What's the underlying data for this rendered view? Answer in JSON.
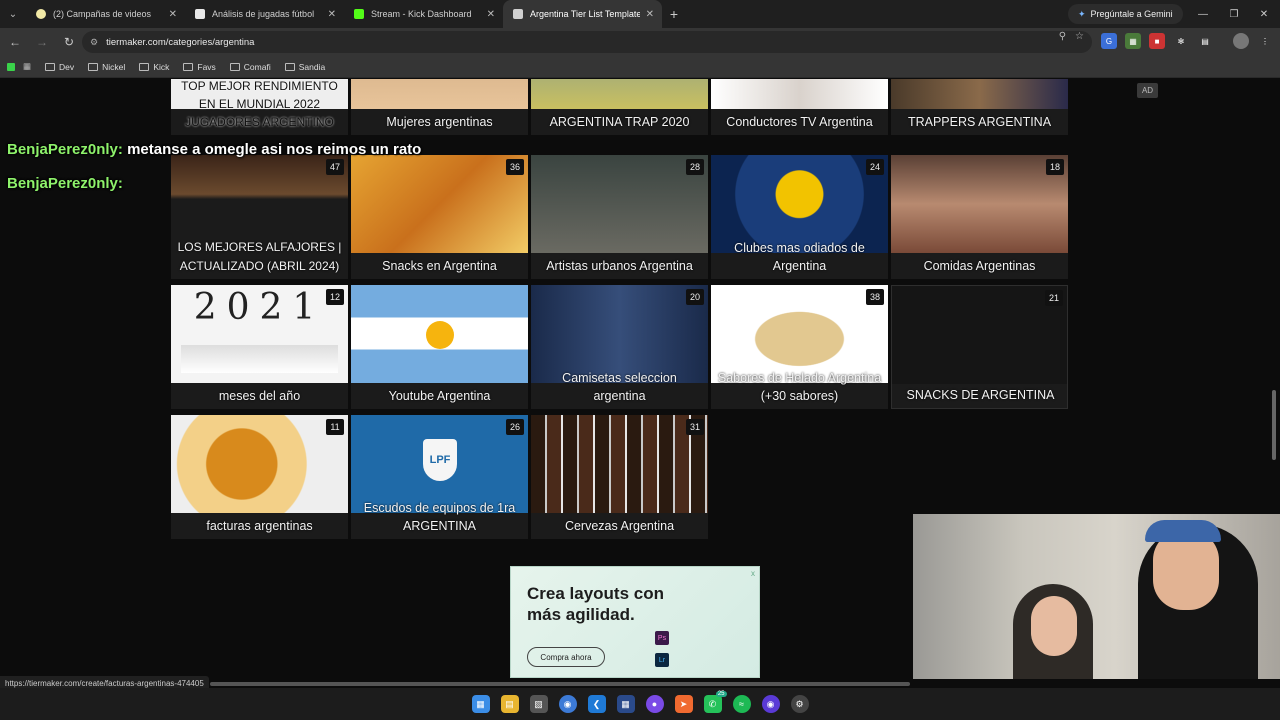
{
  "browser": {
    "tabs": [
      {
        "label": "(2) Campañas de videos",
        "color": "#f2e9a6",
        "active": false
      },
      {
        "label": "Análisis de jugadas fútbol",
        "color": "#e8e8e8",
        "active": false
      },
      {
        "label": "Stream - Kick Dashboard",
        "color": "#53fc18",
        "active": false
      },
      {
        "label": "Argentina Tier List Templates -",
        "color": "#d0d0d0",
        "active": true
      }
    ],
    "gemini_label": "Pregúntale a Gemini",
    "url": "tiermaker.com/categories/argentina",
    "bookmarks": [
      "Dev",
      "Nickel",
      "Kick",
      "Favs",
      "Comafi",
      "Sandia"
    ],
    "status_url": "https://tiermaker.com/create/facturas-argentinas-474405"
  },
  "page": {
    "ad_label": "AD",
    "row0": [
      {
        "title": "TOP MEJOR RENDIMIENTO EN EL MUNDIAL 2022 JUGADORES ARGENTINO",
        "count": ""
      },
      {
        "title": "Mujeres argentinas",
        "count": ""
      },
      {
        "title": "ARGENTINA TRAP 2020",
        "count": ""
      },
      {
        "title": "Conductores TV Argentina",
        "count": ""
      },
      {
        "title": "TRAPPERS ARGENTINA",
        "count": ""
      }
    ],
    "row1": [
      {
        "title": "LOS MEJORES ALFAJORES | ACTUALIZADO (ABRIL 2024)",
        "count": "47"
      },
      {
        "title": "Snacks en Argentina",
        "count": "36"
      },
      {
        "title": "Artistas urbanos Argentina",
        "count": "28"
      },
      {
        "title": "Clubes mas odiados de Argentina",
        "count": "24"
      },
      {
        "title": "Comidas Argentinas",
        "count": "18"
      }
    ],
    "row2": [
      {
        "title": "meses del año",
        "count": "12",
        "big": "2021"
      },
      {
        "title": "Youtube Argentina",
        "count": ""
      },
      {
        "title": "Camisetas seleccion argentina",
        "count": "20"
      },
      {
        "title": "Sabores de Helado Argentina (+30 sabores)",
        "count": "38"
      },
      {
        "title": "SNACKS DE ARGENTINA",
        "count": "21"
      }
    ],
    "row3": [
      {
        "title": "facturas argentinas",
        "count": "11"
      },
      {
        "title": "Escudos de equipos de 1ra ARGENTINA",
        "count": "26",
        "logo": "LPF"
      },
      {
        "title": "Cervezas Argentina",
        "count": "31"
      }
    ],
    "chat": [
      {
        "user": "BenjaPerez0nly:",
        "message": "metanse a omegle asi nos reimos un rato"
      },
      {
        "user": "BenjaPerez0nly:",
        "message": ""
      }
    ],
    "ad": {
      "headline": "Crea layouts con más agilidad.",
      "button": "Compra ahora",
      "ps": "Ps",
      "lr": "Lr",
      "close": "x"
    }
  },
  "taskbar": {
    "badge": "25"
  }
}
